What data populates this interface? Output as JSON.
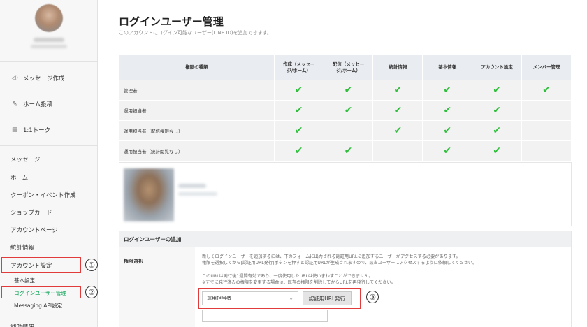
{
  "sidebar": {
    "primary_items": [
      {
        "label": "メッセージ作成",
        "icon": "megaphone-icon",
        "glyph": "◁)"
      },
      {
        "label": "ホーム投稿",
        "icon": "edit-icon",
        "glyph": "✎"
      },
      {
        "label": "1:1トーク",
        "icon": "chat-icon",
        "glyph": "▤"
      }
    ],
    "menu_items": [
      "メッセージ",
      "ホーム",
      "クーポン・イベント作成",
      "ショップカード",
      "アカウントページ",
      "統計情報",
      "アカウント設定"
    ],
    "sub_items": [
      "基本設定",
      "ログインユーザー管理",
      "Messaging API設定"
    ],
    "cutoff_item": "補助情報",
    "annotations": [
      "①",
      "②",
      "③"
    ]
  },
  "main": {
    "title": "ログインユーザー管理",
    "subtitle": "このアカウントにログイン可能なユーザー(LINE ID)を追加できます。",
    "table": {
      "headers": [
        "権限の種類",
        "作成（メッセー\nジ/ホーム）",
        "配信（メッセー\nジ/ホーム）",
        "統計情報",
        "基本情報",
        "アカウント設定",
        "メンバー管理"
      ],
      "check_glyph": "✔",
      "rows": [
        {
          "label": "管理者",
          "checks": [
            true,
            true,
            true,
            true,
            true,
            true
          ]
        },
        {
          "label": "運用担当者",
          "checks": [
            true,
            true,
            true,
            true,
            true,
            false
          ]
        },
        {
          "label": "運用担当者（配信権限なし）",
          "checks": [
            true,
            false,
            true,
            true,
            true,
            false
          ]
        },
        {
          "label": "運用担当者（統計閲覧なし）",
          "checks": [
            true,
            true,
            false,
            true,
            true,
            false
          ]
        }
      ]
    },
    "add_section": {
      "header": "ログインユーザーの追加",
      "label": "権限選択",
      "desc_lines": [
        "新しくログインユーザーを追加するには、下のフォームに出力される認証用URLに追加するユーザーがアクセスする必要があります。",
        "権限を選択してから[認証用URL発行]ボタンを押すと認証用URLが生成されますので、該当ユーザーにアクセスするように依頼してください。",
        "",
        "このURLは発行後1週間有効であり、一度使用したURLは使いまわすことができません。",
        "※すでに発行済みの権限を変更する場合は、既存の権限を削除してからURLを再発行してください。"
      ],
      "select_value": "運用担当者",
      "chevron": "⌄",
      "button_label": "認証用URL発行"
    }
  },
  "colors": {
    "accent": "#2fbe3c",
    "annotation": "#e23b3b",
    "active_link": "#00a050"
  }
}
